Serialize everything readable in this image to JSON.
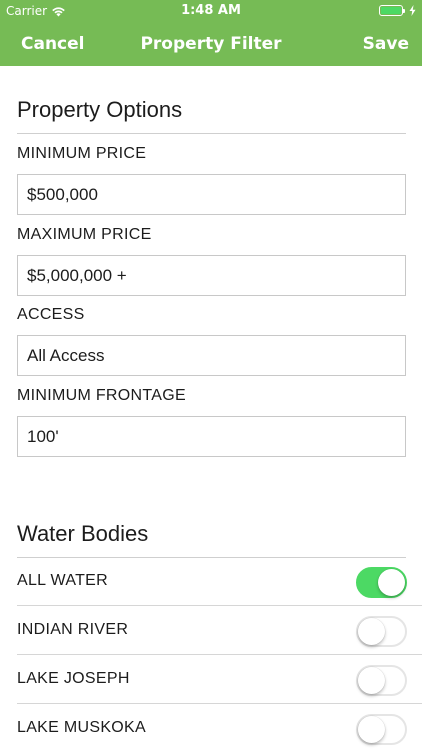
{
  "status_bar": {
    "carrier": "Carrier",
    "time": "1:48 AM",
    "battery_color": "#4cd964"
  },
  "nav": {
    "cancel_label": "Cancel",
    "title": "Property Filter",
    "save_label": "Save",
    "background_color": "#76bb55"
  },
  "property_options": {
    "title": "Property Options",
    "fields": [
      {
        "label": "MINIMUM PRICE",
        "value": "$500,000"
      },
      {
        "label": "MAXIMUM PRICE",
        "value": "$5,000,000 +"
      },
      {
        "label": "ACCESS",
        "value": "All Access"
      },
      {
        "label": "MINIMUM FRONTAGE",
        "value": "100'"
      }
    ]
  },
  "water_bodies": {
    "title": "Water Bodies",
    "toggle_on_color": "#4cd964",
    "items": [
      {
        "label": "ALL WATER",
        "enabled": true
      },
      {
        "label": "INDIAN RIVER",
        "enabled": false
      },
      {
        "label": "LAKE JOSEPH",
        "enabled": false
      },
      {
        "label": "LAKE MUSKOKA",
        "enabled": false
      }
    ]
  },
  "icons": [
    "wifi-icon",
    "battery-icon",
    "charging-icon"
  ]
}
